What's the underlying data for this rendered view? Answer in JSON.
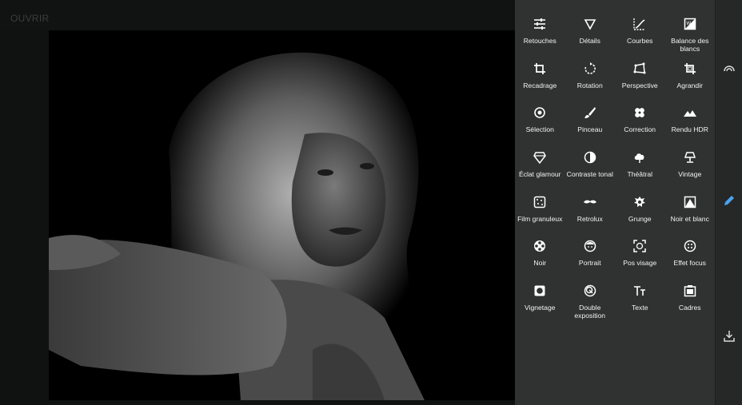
{
  "header": {
    "open_label": "OUVRIR"
  },
  "tools": [
    {
      "label": "Retouches",
      "icon": "sliders-icon"
    },
    {
      "label": "Détails",
      "icon": "triangle-down-icon"
    },
    {
      "label": "Courbes",
      "icon": "curves-icon"
    },
    {
      "label": "Balance des blancs",
      "icon": "white-balance-icon"
    },
    {
      "label": "Recadrage",
      "icon": "crop-icon"
    },
    {
      "label": "Rotation",
      "icon": "rotate-icon"
    },
    {
      "label": "Perspective",
      "icon": "perspective-icon"
    },
    {
      "label": "Agrandir",
      "icon": "expand-icon"
    },
    {
      "label": "Sélection",
      "icon": "target-icon"
    },
    {
      "label": "Pinceau",
      "icon": "brush-icon"
    },
    {
      "label": "Correction",
      "icon": "bandage-icon"
    },
    {
      "label": "Rendu HDR",
      "icon": "mountain-icon"
    },
    {
      "label": "Éclat glamour",
      "icon": "diamond-icon"
    },
    {
      "label": "Contraste tonal",
      "icon": "contrast-icon"
    },
    {
      "label": "Théâtral",
      "icon": "cloud-icon"
    },
    {
      "label": "Vintage",
      "icon": "lamp-icon"
    },
    {
      "label": "Film granuleux",
      "icon": "grain-icon"
    },
    {
      "label": "Retrolux",
      "icon": "mustache-icon"
    },
    {
      "label": "Grunge",
      "icon": "grunge-icon"
    },
    {
      "label": "Noir et blanc",
      "icon": "bw-icon"
    },
    {
      "label": "Noir",
      "icon": "film-reel-icon"
    },
    {
      "label": "Portrait",
      "icon": "face-icon"
    },
    {
      "label": "Pos visage",
      "icon": "face-frame-icon"
    },
    {
      "label": "Effet focus",
      "icon": "focus-icon"
    },
    {
      "label": "Vignetage",
      "icon": "vignette-icon"
    },
    {
      "label": "Double exposition",
      "icon": "double-exposure-icon"
    },
    {
      "label": "Texte",
      "icon": "text-icon"
    },
    {
      "label": "Cadres",
      "icon": "frame-icon"
    }
  ],
  "rail": {
    "looks_icon": "looks-icon",
    "edit_icon": "pencil-icon",
    "export_icon": "download-icon",
    "active_color": "#4aa3f0"
  }
}
